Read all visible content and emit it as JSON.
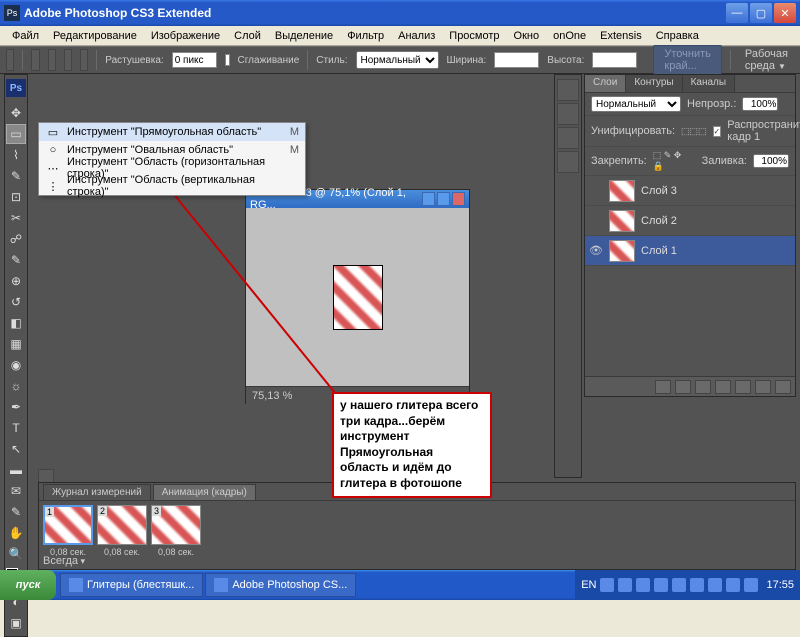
{
  "window": {
    "title": "Adobe Photoshop CS3 Extended",
    "app_icon": "Ps"
  },
  "menu": [
    "Файл",
    "Редактирование",
    "Изображение",
    "Слой",
    "Выделение",
    "Фильтр",
    "Анализ",
    "Просмотр",
    "Окно",
    "onOne",
    "Extensis",
    "Справка"
  ],
  "options": {
    "feather_label": "Растушевка:",
    "feather_value": "0 пикс",
    "antialias_label": "Сглаживание",
    "width_label": "Ширина:",
    "height_label": "Высота:",
    "style_label": "Стиль:",
    "style_value": "Нормальный",
    "refine": "Уточнить край...",
    "workspace": "Рабочая среда"
  },
  "context_menu": {
    "items": [
      {
        "icon": "▭",
        "label": "Инструмент \"Прямоугольная область\"",
        "shortcut": "M",
        "selected": true
      },
      {
        "icon": "○",
        "label": "Инструмент \"Овальная область\"",
        "shortcut": "M",
        "selected": false
      },
      {
        "icon": "⋯",
        "label": "Инструмент \"Область (горизонтальная строка)\"",
        "shortcut": "",
        "selected": false
      },
      {
        "icon": "⋮",
        "label": "Инструмент \"Область (вертикальная строка)\"",
        "shortcut": "",
        "selected": false
      }
    ]
  },
  "document": {
    "title": "Безымени-3 @ 75,1% (Слой 1, RG...",
    "zoom": "75,13 %"
  },
  "annotation": "у нашего глитера всего три кадра...берём инструмент Прямоугольная область и идём до глитера в фотошопе",
  "animation_panel": {
    "tabs": [
      "Журнал измерений",
      "Анимация (кадры)"
    ],
    "active_tab": 1,
    "frames": [
      {
        "num": "1",
        "delay": "0,08 сек."
      },
      {
        "num": "2",
        "delay": "0,08 сек."
      },
      {
        "num": "3",
        "delay": "0,08 сек."
      }
    ],
    "loop": "Всегда"
  },
  "layers_panel": {
    "tabs": [
      "Слои",
      "Контуры",
      "Каналы"
    ],
    "blend_mode": "Нормальный",
    "opacity_label": "Непрозр.:",
    "opacity": "100%",
    "unify_label": "Унифицировать:",
    "propagate_label": "Распространить кадр 1",
    "lock_label": "Закрепить:",
    "fill_label": "Заливка:",
    "fill": "100%",
    "layers": [
      {
        "name": "Слой 3",
        "visible": false,
        "selected": false
      },
      {
        "name": "Слой 2",
        "visible": false,
        "selected": false
      },
      {
        "name": "Слой 1",
        "visible": true,
        "selected": true
      }
    ]
  },
  "taskbar": {
    "start": "пуск",
    "tasks": [
      "Глитеры (блестяшк...",
      "Adobe Photoshop CS..."
    ],
    "lang": "EN",
    "time": "17:55"
  }
}
